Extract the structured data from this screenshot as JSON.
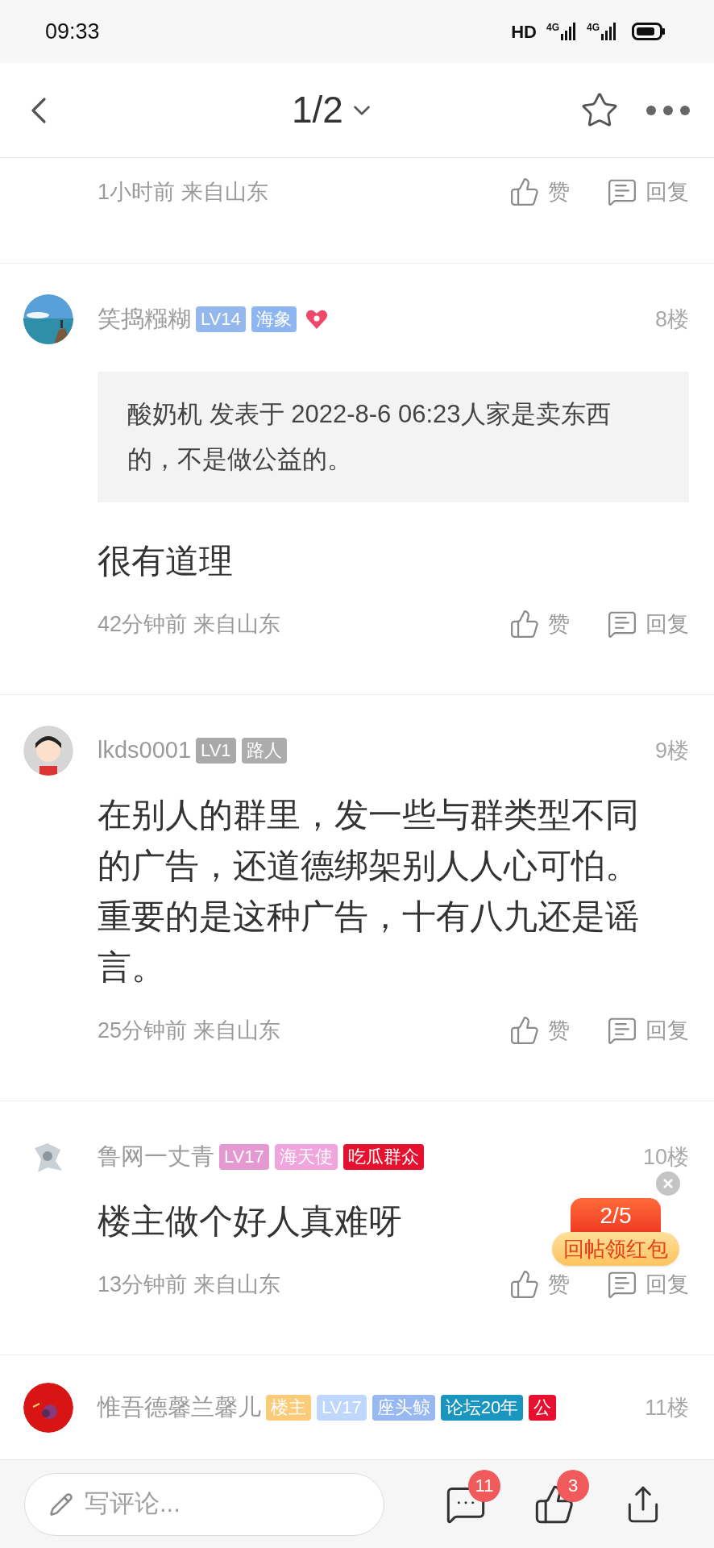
{
  "status_bar": {
    "time": "09:33",
    "hd": "HD",
    "networks": [
      "4G",
      "4G"
    ]
  },
  "header": {
    "page": "1/2"
  },
  "posts": [
    {
      "kind": "partial",
      "meta": "1小时前 来自山东",
      "like": "赞",
      "reply": "回复"
    },
    {
      "kind": "full",
      "name": "笑捣糨糊",
      "badges": [
        {
          "kind": "tag",
          "text": "LV14",
          "color": "#94b8ee"
        },
        {
          "kind": "tag",
          "text": "海象",
          "color": "#8db5f2"
        },
        {
          "kind": "heart",
          "color": "#f0486a"
        }
      ],
      "floor": "8楼",
      "quote": "酸奶机 发表于 2022-8-6 06:23人家是卖东西的，不是做公益的。",
      "body": "很有道理",
      "meta": "42分钟前 来自山东",
      "like": "赞",
      "reply": "回复"
    },
    {
      "kind": "full",
      "name": "lkds0001",
      "badges": [
        {
          "kind": "tag",
          "text": "LV1",
          "color": "#a9a9a9"
        },
        {
          "kind": "tag",
          "text": "路人",
          "color": "#acacac"
        }
      ],
      "floor": "9楼",
      "body": "在别人的群里，发一些与群类型不同的广告，还道德绑架别人人心可怕。重要的是这种广告，十有八九还是谣言。",
      "meta": "25分钟前 来自山东",
      "like": "赞",
      "reply": "回复"
    },
    {
      "kind": "full",
      "name": "鲁网一丈青",
      "badges": [
        {
          "kind": "tag",
          "text": "LV17",
          "color": "#e49ad0"
        },
        {
          "kind": "tag",
          "text": "海天使",
          "color": "#f0a5dc"
        },
        {
          "kind": "tag",
          "text": "吃瓜群众",
          "color": "#e6112f"
        }
      ],
      "floor": "10楼",
      "body": "楼主做个好人真难呀",
      "meta": "13分钟前 来自山东",
      "like": "赞",
      "reply": "回复"
    },
    {
      "kind": "header_only",
      "name": "惟吾德馨兰馨儿",
      "badges": [
        {
          "kind": "tag",
          "text": "楼主",
          "color": "#fbcb7a"
        },
        {
          "kind": "tag",
          "text": "LV17",
          "color": "#bfd7fc"
        },
        {
          "kind": "tag",
          "text": "座头鲸",
          "color": "#98b8f2"
        },
        {
          "kind": "tag",
          "text": "论坛20年",
          "color": "#1a95c0"
        },
        {
          "kind": "tag",
          "text": "公",
          "color": "#e6112f"
        }
      ],
      "floor": "11楼"
    }
  ],
  "red_packet": {
    "count": "2/5",
    "label": "回帖领红包"
  },
  "bottom_bar": {
    "placeholder": "写评论...",
    "comment_count": "11",
    "like_count": "3"
  }
}
